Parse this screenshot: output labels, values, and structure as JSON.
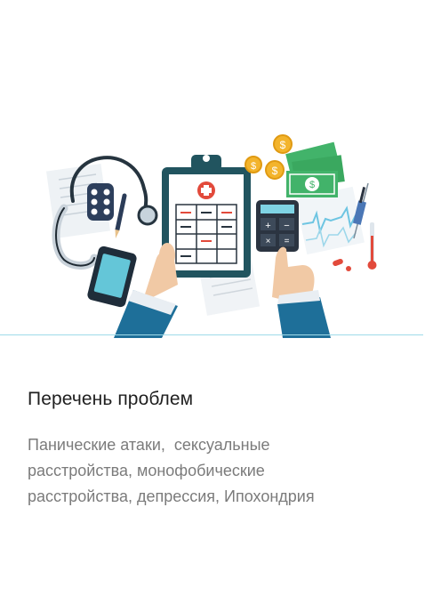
{
  "card": {
    "title": "Перечень проблем",
    "description_lines": [
      "Панические атаки,  сексуальные",
      "расстройства, монофобические",
      "расстройства, депрессия, Ипохондрия"
    ]
  },
  "colors": {
    "accent_divider": "#9fdbe9",
    "title_text": "#1f1f1f",
    "body_text": "#7b7b7b",
    "clipboard": "#21545f",
    "sleeve": "#1e6f99",
    "money_green": "#42b36a",
    "coin_gold": "#f3b42c",
    "medical_red": "#e24a3b"
  },
  "illustration": {
    "icons": [
      "stethoscope-icon",
      "pill-blister-icon",
      "pencil-icon",
      "smartphone-icon",
      "clipboard-icon",
      "medical-cross-icon",
      "calculator-icon",
      "banknote-icon",
      "coin-icon",
      "syringe-icon",
      "thermometer-icon",
      "pill-icon",
      "cardiogram-icon"
    ]
  }
}
